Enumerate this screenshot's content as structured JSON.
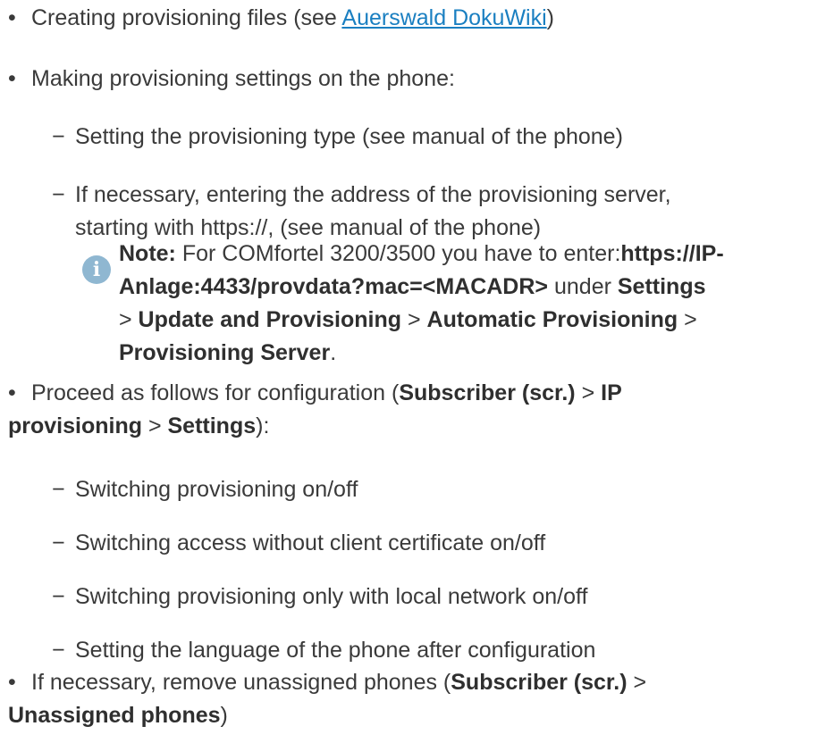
{
  "items": {
    "i1": {
      "text": "Creating provisioning files (see ",
      "link": "Auerswald DokuWiki",
      "after": ")"
    },
    "i2": {
      "text": "Making provisioning settings on the phone:"
    },
    "i2_sub1": "Setting the provisioning type (see manual of the phone)",
    "i2_sub2_line1": "If necessary, entering the address of the provisioning server,",
    "i2_sub2_line2": "starting with https://, (see manual of the phone)",
    "note": {
      "label": "Note:",
      "t1": " For COMfortel 3200/3500 you have to enter:",
      "b1": "https://IP-",
      "b2": "Anlage:4433/provdata?mac=<MACADR>",
      "t2": " under ",
      "b3": "Settings",
      "sep1": "> ",
      "b4": "Update and Provisioning",
      "sep2": " > ",
      "b5": "Automatic Provisioning",
      "sep3": " >",
      "b6": "Provisioning Server",
      "end": "."
    },
    "i3": {
      "t1": "Proceed as follows for configuration (",
      "b1": "Subscriber (scr.)",
      "sep1": " > ",
      "b2": "IP",
      "b3": "provisioning",
      "sep2": " > ",
      "b4": "Settings",
      "end": "):"
    },
    "i3_sub1": "Switching provisioning on/off",
    "i3_sub2": "Switching access without client certificate on/off",
    "i3_sub3": "Switching provisioning only with local network on/off",
    "i3_sub4": "Setting the language of the phone after configuration",
    "i4": {
      "t1": "If necessary, remove unassigned phones (",
      "b1": "Subscriber (scr.)",
      "sep1": " >",
      "b2": "Unassigned phones",
      "end": ")"
    }
  },
  "glyphs": {
    "bullet": "•",
    "dash": "−",
    "info_icon": "info-icon"
  },
  "colors": {
    "text": "#3a3a3a",
    "link": "#1a7fc1",
    "icon": "#8fb7d1"
  }
}
